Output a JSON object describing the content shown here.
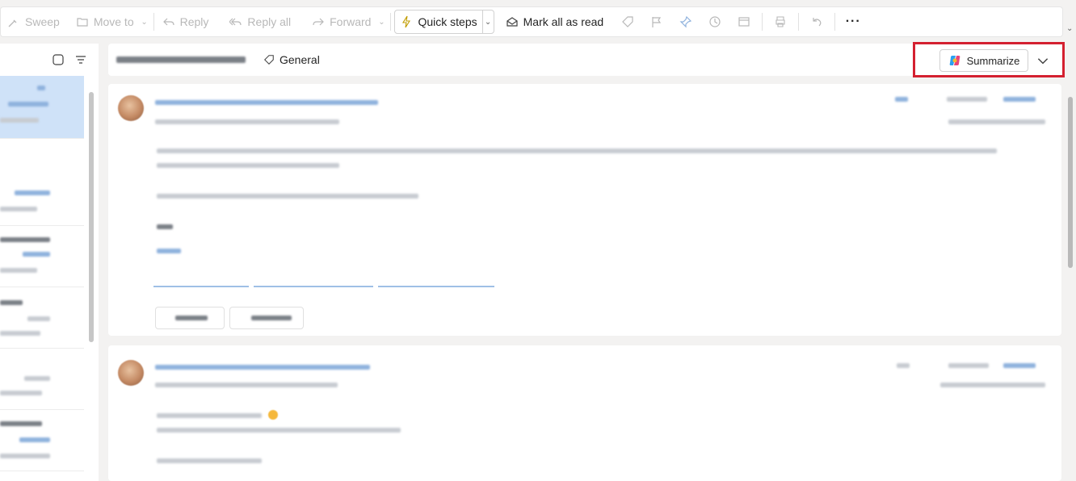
{
  "toolbar": {
    "sweep": "Sweep",
    "move_to": "Move to",
    "reply": "Reply",
    "reply_all": "Reply all",
    "forward": "Forward",
    "quick_steps": "Quick steps",
    "mark_all_read": "Mark all as read",
    "more": "···"
  },
  "reading": {
    "tag_label": "General",
    "summarize_label": "Summarize"
  },
  "colors": {
    "highlight_frame": "#d42030",
    "selected_item": "#cfe2f8"
  }
}
